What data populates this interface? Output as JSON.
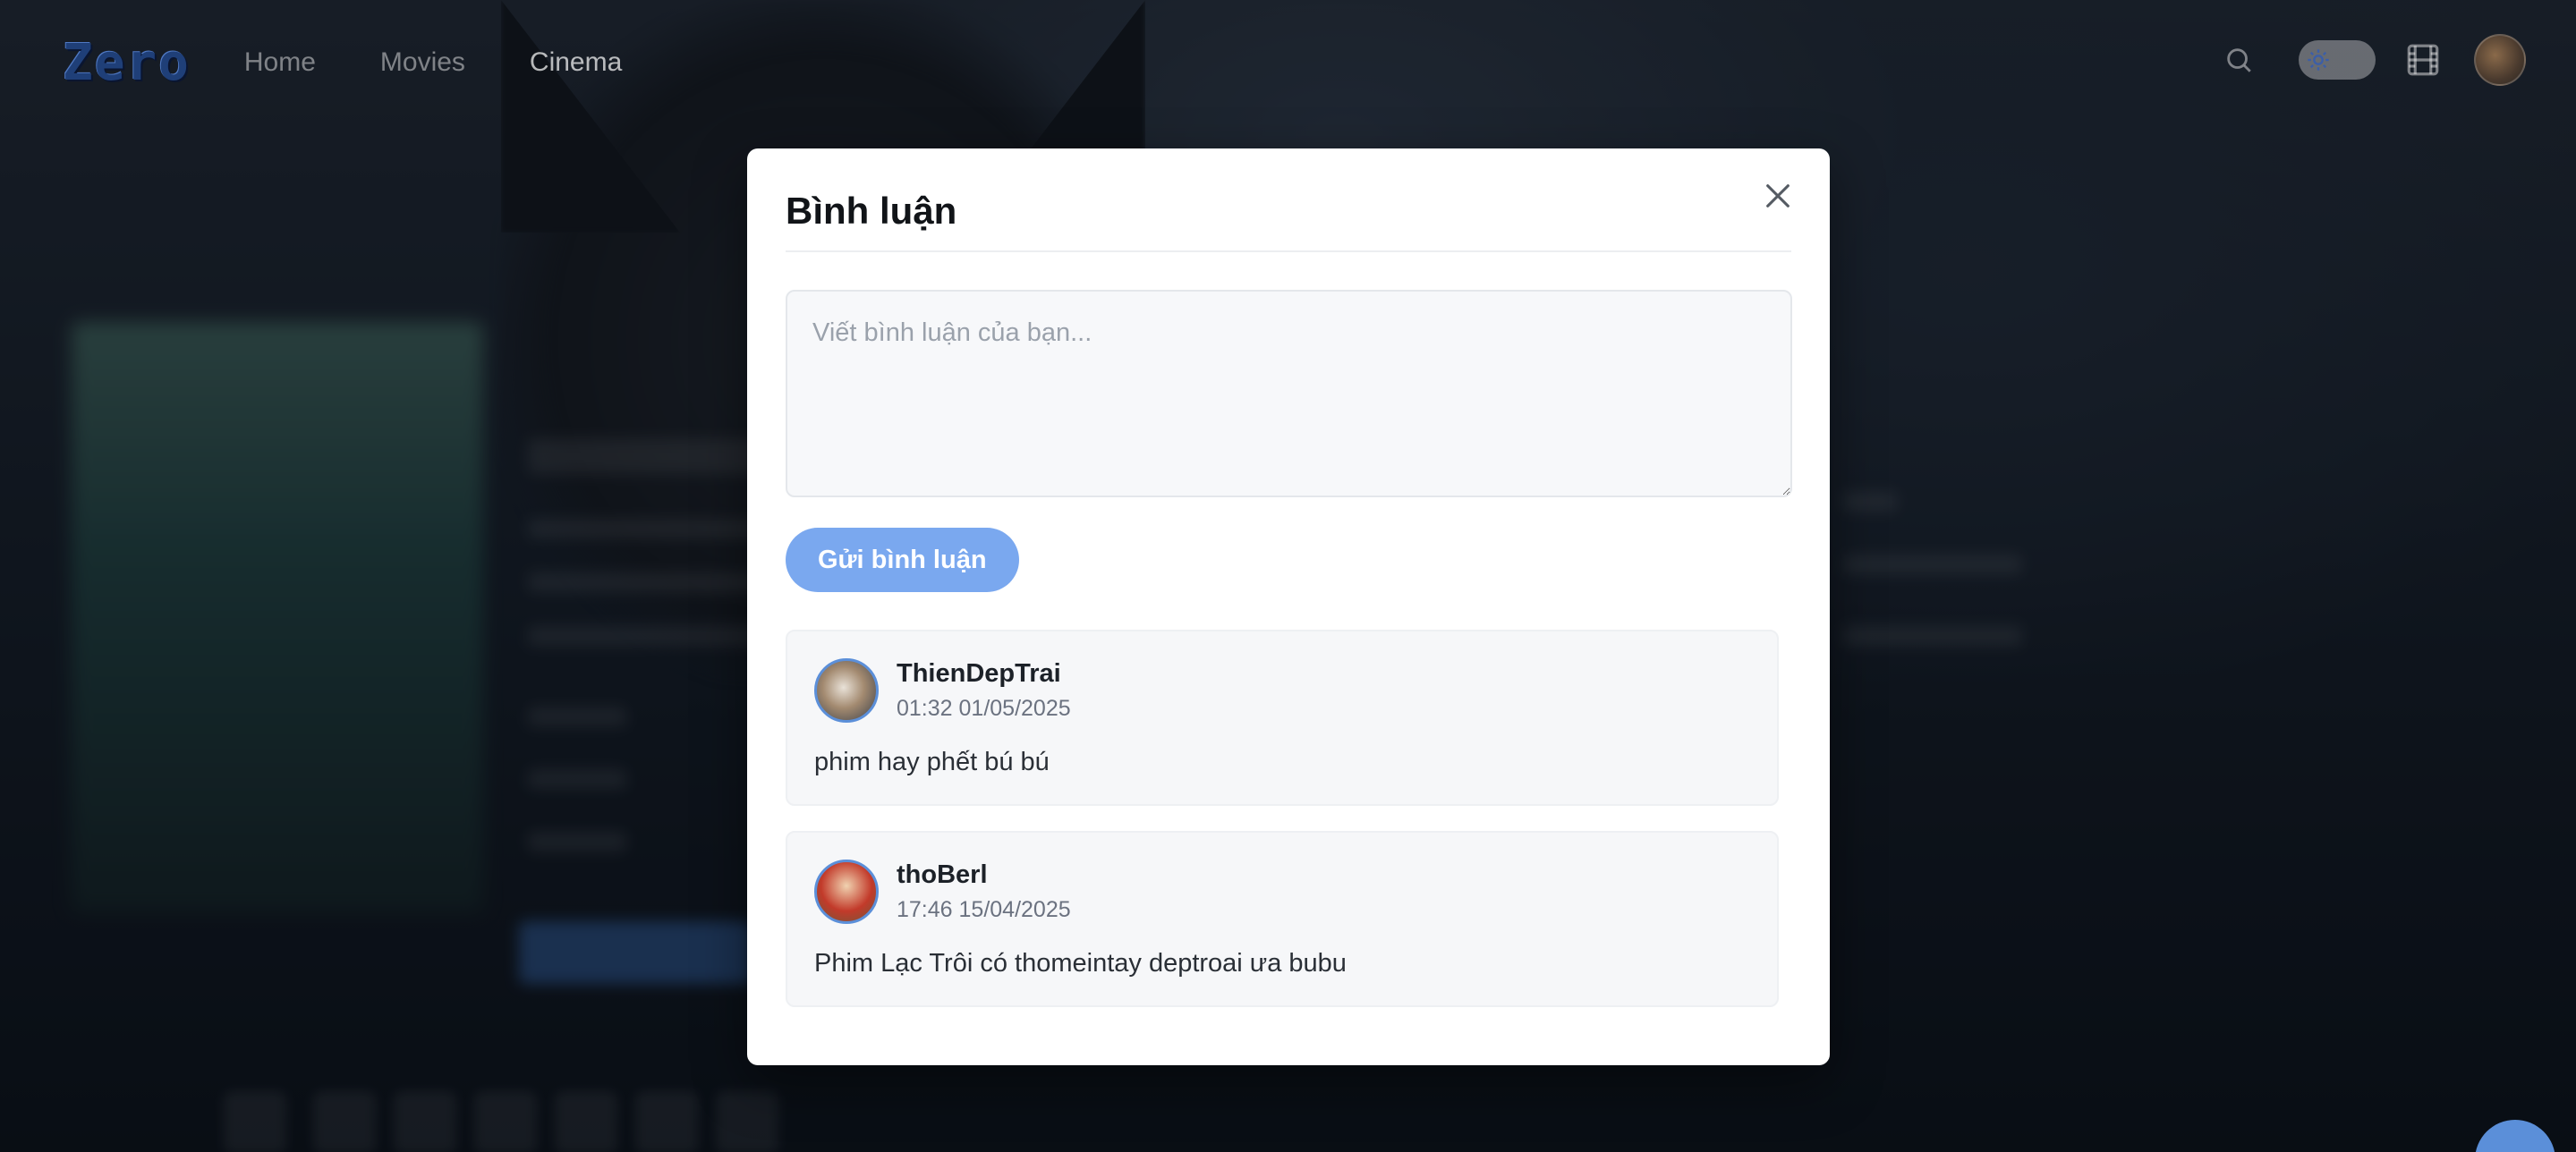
{
  "nav": {
    "logo": "Zero",
    "links": [
      {
        "label": "Home"
      },
      {
        "label": "Movies"
      },
      {
        "label": "Cinema"
      }
    ],
    "icons": [
      "search-icon",
      "sun-icon",
      "film-icon",
      "avatar"
    ]
  },
  "modal": {
    "title": "Bình luận",
    "input_placeholder": "Viết bình luận của bạn...",
    "submit_label": "Gửi bình luận",
    "comments": [
      {
        "user": "ThienDepTrai",
        "time": "01:32 01/05/2025",
        "text": "phim hay phết bú bú"
      },
      {
        "user": "thoBerl",
        "time": "17:46 15/04/2025",
        "text": "Phim Lạc Trôi có thomeintay deptroai ưa bubu"
      }
    ]
  },
  "colors": {
    "accent": "#5b8fd9",
    "submit_button": "#7aa8ef",
    "modal_bg": "#ffffff"
  }
}
